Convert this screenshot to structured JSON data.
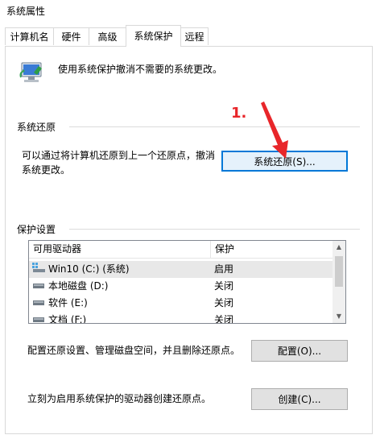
{
  "window": {
    "title": "系统属性"
  },
  "tabs": [
    {
      "label": "计算机名"
    },
    {
      "label": "硬件"
    },
    {
      "label": "高级"
    },
    {
      "label": "系统保护"
    },
    {
      "label": "远程"
    }
  ],
  "intro": {
    "text": "使用系统保护撤消不需要的系统更改。"
  },
  "restore": {
    "section_title": "系统还原",
    "desc_line1": "可以通过将计算机还原到上一个还原点，撤消",
    "desc_line2": "系统更改。",
    "button_label": "系统还原(S)..."
  },
  "protection": {
    "section_title": "保护设置",
    "columns": [
      "可用驱动器",
      "保护"
    ],
    "drives": [
      {
        "name": "Win10 (C:) (系统)",
        "status": "启用",
        "icon": "system-drive-icon"
      },
      {
        "name": "本地磁盘 (D:)",
        "status": "关闭",
        "icon": "drive-icon"
      },
      {
        "name": "软件 (E:)",
        "status": "关闭",
        "icon": "drive-icon"
      },
      {
        "name": "文档 (F:)",
        "status": "关闭",
        "icon": "drive-icon"
      }
    ],
    "config_text": "配置还原设置、管理磁盘空间，并且删除还原点。",
    "config_button": "配置(O)...",
    "create_text": "立刻为启用系统保护的驱动器创建还原点。",
    "create_button": "创建(C)..."
  },
  "annotation": {
    "number": "1.",
    "color": "#e8262a"
  }
}
